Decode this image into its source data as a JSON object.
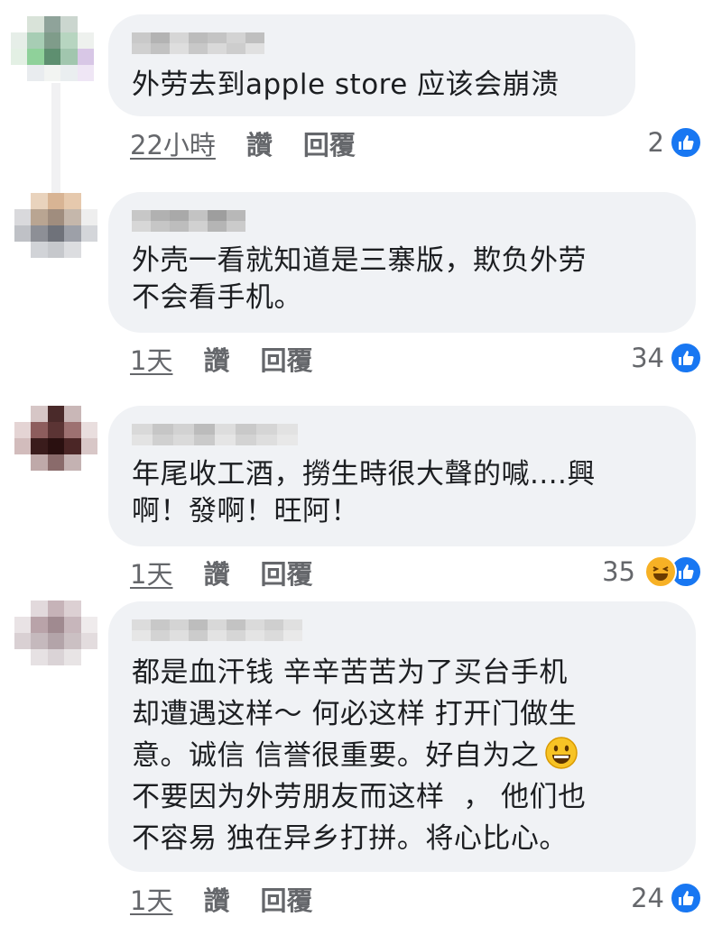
{
  "comments": [
    {
      "text": "外劳去到apple store 应该会崩溃",
      "time": "22小時",
      "like_label": "讚",
      "reply_label": "回覆",
      "reaction_count": "2",
      "reactions": [
        "like-icon"
      ]
    },
    {
      "text": "外壳一看就知道是三寨版，欺负外劳\n不会看手机。",
      "time": "1天",
      "like_label": "讚",
      "reply_label": "回覆",
      "reaction_count": "34",
      "reactions": [
        "like-icon"
      ]
    },
    {
      "text": "年尾收工酒，撈生時很大聲的喊....興\n啊！發啊！旺阿！",
      "time": "1天",
      "like_label": "讚",
      "reply_label": "回覆",
      "reaction_count": "35",
      "reactions": [
        "haha-icon",
        "like-icon"
      ]
    },
    {
      "text_lines": [
        "都是血汗钱 辛辛苦苦为了买台手机",
        "却遭遇这样～ 何必这样 打开门做生",
        "意。诚信 信誉很重要。好自为之",
        "不要因为外劳朋友而这样  ， 他们也",
        "不容易 独在异乡打拼。将心比心。"
      ],
      "time": "1天",
      "like_label": "讚",
      "reply_label": "回覆",
      "reaction_count": "24",
      "reactions": [
        "like-icon"
      ],
      "inline_emoji": "smiling-face-icon"
    }
  ],
  "colors": {
    "bubble": "#f0f2f5",
    "text": "#1c1e21",
    "meta": "#65676b",
    "like": "#1877f2",
    "haha": "#f7b125"
  }
}
